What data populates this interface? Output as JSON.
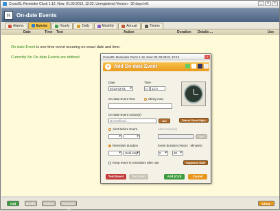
{
  "app": {
    "title": "CrossGL Reminder Clock 1.12, Now: 01.03.2013, 12:32, Unregistered Version - 30 days left.",
    "header_title": "On-date Events",
    "cal_icon_text": "31"
  },
  "tabs": [
    {
      "label": "Alarms",
      "color": "#d04a3a"
    },
    {
      "label": "Events",
      "color": "#2f7fd0",
      "active": true
    },
    {
      "label": "Hourly",
      "color": "#3ca34a"
    },
    {
      "label": "Daily",
      "color": "#d4a02a"
    },
    {
      "label": "Monthly",
      "color": "#8a5ac0"
    },
    {
      "label": "Annual",
      "color": "#c05a3a"
    },
    {
      "label": "Timers",
      "color": "#555555"
    }
  ],
  "columns": [
    "Date",
    "Time",
    "Text",
    "Action",
    "Duration",
    "Details ...",
    "Use"
  ],
  "content": {
    "line1_highlight": "On-date Event",
    "line1_rest": " is one time event occuring on exact date and time.",
    "line2": "Currently No On-date Events are defined."
  },
  "bottom": {
    "add": "Add",
    "modify": "Modify",
    "delete": "Delete",
    "remove": "Remove All",
    "close": "Close"
  },
  "dialog": {
    "window_title": "CrossGL Reminder Clock 1.12, Now: 01.03.2013, 12:12",
    "header": "Add On-date Event",
    "date_label": "Date",
    "date_value": "2013-03-01",
    "time_label": "Time",
    "time_value": "12:0",
    "event_text_label": "On-date Event Text",
    "sticky_note": "Sticky note",
    "event_text_value": "",
    "action_label": "On-date Event Action(s)",
    "action_value": "Not Defined ...",
    "set_button": "Set",
    "clock_style_button": "Select Clock Style",
    "alert_before": "Alert before Event",
    "alert_action": "Alert Action(s)",
    "set2_button": "Set",
    "reminder_duration": "Reminder duration",
    "until_stop": "Until stop",
    "event_duration_label": "Event duration (Hours : Minutes)",
    "event_hours": "0",
    "event_minutes": "30",
    "keep_event": "Keep event in reminders after use",
    "suppress_button": "Suppress Date",
    "test_button": "Test Event",
    "preview_button": "Test Alert",
    "add_button": "Add [Ctrl]",
    "cancel_button": "Cancel"
  }
}
